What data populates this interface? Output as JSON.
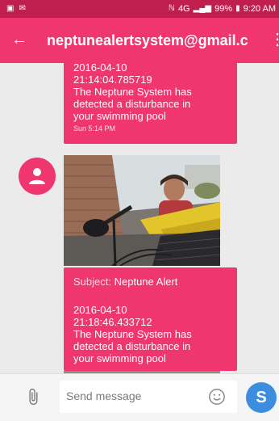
{
  "status_bar": {
    "signal": "4G",
    "battery": "99%",
    "time": "9:20 AM"
  },
  "app_bar": {
    "title": "neptunealertsystem@gmail.c",
    "back_icon": "arrow-back-icon",
    "menu_icon": "more-vert-icon"
  },
  "messages": [
    {
      "body": "2016-04-10\n21:14:04.785719\nThe Neptune System has\ndetected a disturbance in\nyour swimming pool",
      "timestamp": "Sun 5:14 PM"
    },
    {
      "attachment": "pool-camera-photo",
      "subject_label": "Subject:",
      "subject": "Neptune Alert",
      "body": "2016-04-10\n21:18:46.433712\nThe Neptune System has\ndetected a disturbance in\nyour swimming pool"
    }
  ],
  "compose": {
    "placeholder": "Send message",
    "send_label": "S"
  },
  "colors": {
    "accent": "#f0366e",
    "status_bar": "#c01f4d",
    "send_button": "#3d8ddf",
    "background": "#ebebeb"
  }
}
